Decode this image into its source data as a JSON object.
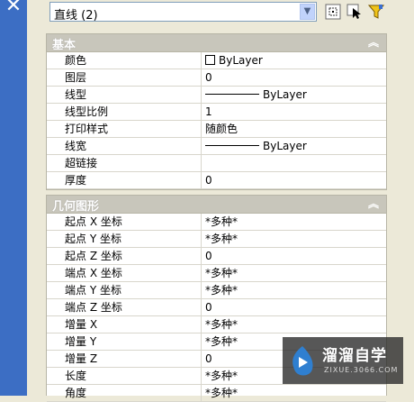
{
  "selector": {
    "value": "直线 (2)"
  },
  "sections": [
    {
      "title": "基本",
      "rows": [
        {
          "key": "颜色",
          "value": "ByLayer",
          "kind": "color"
        },
        {
          "key": "图层",
          "value": "0"
        },
        {
          "key": "线型",
          "value": "ByLayer",
          "kind": "line"
        },
        {
          "key": "线型比例",
          "value": "1"
        },
        {
          "key": "打印样式",
          "value": "随颜色"
        },
        {
          "key": "线宽",
          "value": "ByLayer",
          "kind": "line"
        },
        {
          "key": "超链接",
          "value": ""
        },
        {
          "key": "厚度",
          "value": "0"
        }
      ]
    },
    {
      "title": "几何图形",
      "rows": [
        {
          "key": "起点 X 坐标",
          "value": "*多种*"
        },
        {
          "key": "起点 Y 坐标",
          "value": "*多种*"
        },
        {
          "key": "起点 Z 坐标",
          "value": "0"
        },
        {
          "key": "端点 X 坐标",
          "value": "*多种*"
        },
        {
          "key": "端点 Y 坐标",
          "value": "*多种*"
        },
        {
          "key": "端点 Z 坐标",
          "value": "0"
        },
        {
          "key": "增量 X",
          "value": "*多种*"
        },
        {
          "key": "增量 Y",
          "value": "*多种*"
        },
        {
          "key": "增量 Z",
          "value": "0"
        },
        {
          "key": "长度",
          "value": "*多种*"
        },
        {
          "key": "角度",
          "value": "*多种*"
        }
      ]
    }
  ],
  "watermark": {
    "name": "溜溜自学",
    "site": "ZIXUE.3066.COM"
  },
  "colors": {
    "panel_header": "#c8c6bb",
    "sidebar": "#3c6ec4",
    "dialog_bg": "#ece9d8"
  }
}
